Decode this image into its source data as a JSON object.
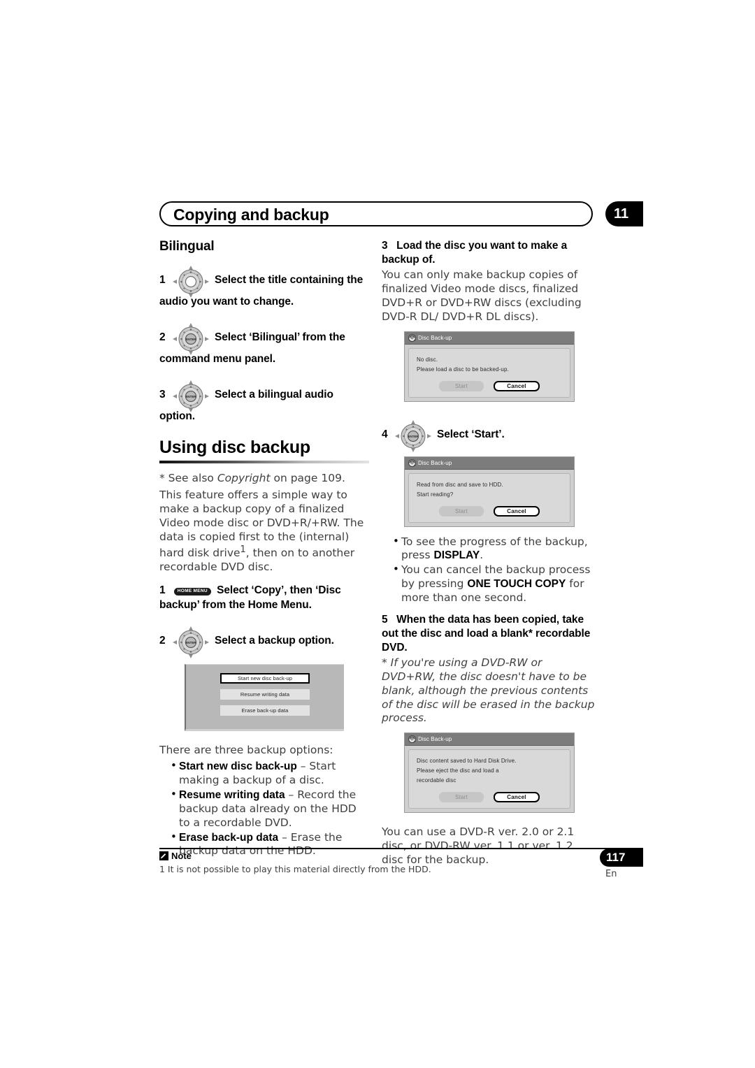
{
  "header": {
    "title": "Copying and backup",
    "chapter": "11"
  },
  "left": {
    "bilingual_heading": "Bilingual",
    "steps": [
      {
        "num": "1",
        "icon": "cursor-dpad-icon",
        "text": "Select the title containing the audio you want to change."
      },
      {
        "num": "2",
        "icon": "cursor-enter-dpad-icon",
        "text": "Select ‘Bilingual’ from the command menu panel."
      },
      {
        "num": "3",
        "icon": "cursor-enter-dpad-icon",
        "text": "Select a bilingual audio option."
      }
    ],
    "section_heading": "Using disc backup",
    "copyright_note": "* See also Copyright on page 109.",
    "copyright_note_plain": "* See also ",
    "copyright_italic": "Copyright",
    "copyright_tail": " on page 109.",
    "intro_line1": "This feature offers a simple way to make a",
    "intro_line2": "backup copy of a finalized Video mode disc",
    "intro_line3": "or DVD+R/+RW. The data is copied first to",
    "intro_line4a": "the (internal) hard disk drive",
    "intro_footnote": "1",
    "intro_line4b": ", then on to",
    "intro_line5": "another recordable DVD disc.",
    "step1_num": "1",
    "step1_button_label": "HOME MENU",
    "step1_text": "Select ‘Copy’, then ‘Disc backup’ from the Home Menu.",
    "step2_num": "2",
    "step2_text": "Select a backup option.",
    "osd_menu": {
      "items": [
        {
          "label": "Start new disc back-up",
          "selected": true
        },
        {
          "label": "Resume writing data",
          "selected": false
        },
        {
          "label": "Erase back-up data",
          "selected": false
        }
      ]
    },
    "options_intro": "There are three backup options:",
    "option_bullets": [
      {
        "term": "Start new disc back-up",
        "desc": " – Start making a backup of a disc."
      },
      {
        "term": "Resume writing data",
        "desc": " – Record the backup data already on the HDD to a recordable DVD."
      },
      {
        "term": "Erase back-up data",
        "desc": " – Erase the backup data on the HDD."
      }
    ]
  },
  "right": {
    "step3_num": "3",
    "step3_text": "Load the disc you want to make a backup of.",
    "step3_body_l1": "You can only make backup copies of",
    "step3_body_l2": "finalized Video mode discs, finalized DVD+R",
    "step3_body_l3": "or  DVD+RW discs (excluding DVD-R DL/",
    "step3_body_l4": "DVD+R DL discs).",
    "dialog1": {
      "title": "Disc Back-up",
      "icon": "disc-arrow-icon",
      "lines": [
        "No disc.",
        "Please load a disc to be backed-up."
      ],
      "start_label": "Start",
      "cancel_label": "Cancel"
    },
    "step4_num": "4",
    "step4_icon": "cursor-enter-dpad-icon",
    "step4_text": "Select ‘Start’.",
    "dialog2": {
      "title": "Disc Back-up",
      "icon": "disc-arrow-icon",
      "lines": [
        "Read from disc and save to HDD.",
        "Start reading?"
      ],
      "start_label": "Start",
      "cancel_label": "Cancel"
    },
    "bullets": [
      {
        "pre": "To see the progress of the backup, press ",
        "bold": "DISPLAY",
        "post": "."
      },
      {
        "pre": "You can cancel the backup process by pressing ",
        "bold": "ONE TOUCH COPY",
        "post": " for more than one second."
      }
    ],
    "step5_num": "5",
    "step5_text": "When the data has been copied, take out the disc and load a blank* recordable DVD.",
    "step5_italic_note": "* If you're using a DVD-RW or DVD+RW, the disc doesn't have to be blank, although the previous contents of the disc will be erased in the backup process.",
    "dialog3": {
      "title": "Disc Back-up",
      "icon": "disc-arrow-icon",
      "lines": [
        "Disc content saved to Hard Disk Drive.",
        "Please eject the disc and load a",
        "recordable disc"
      ],
      "start_label": "Start",
      "cancel_label": "Cancel"
    },
    "closing_l1": "You can use a DVD-R ver. 2.0 or 2.1 disc, or",
    "closing_l2": "DVD-RW ver. 1.1 or ver. 1.2 disc for the",
    "closing_l3": "backup."
  },
  "footer": {
    "note_label": "Note",
    "note_icon": "pencil-icon",
    "note_text": "1 It is not possible to play this material directly from the HDD.",
    "page_number": "117",
    "language": "En"
  }
}
